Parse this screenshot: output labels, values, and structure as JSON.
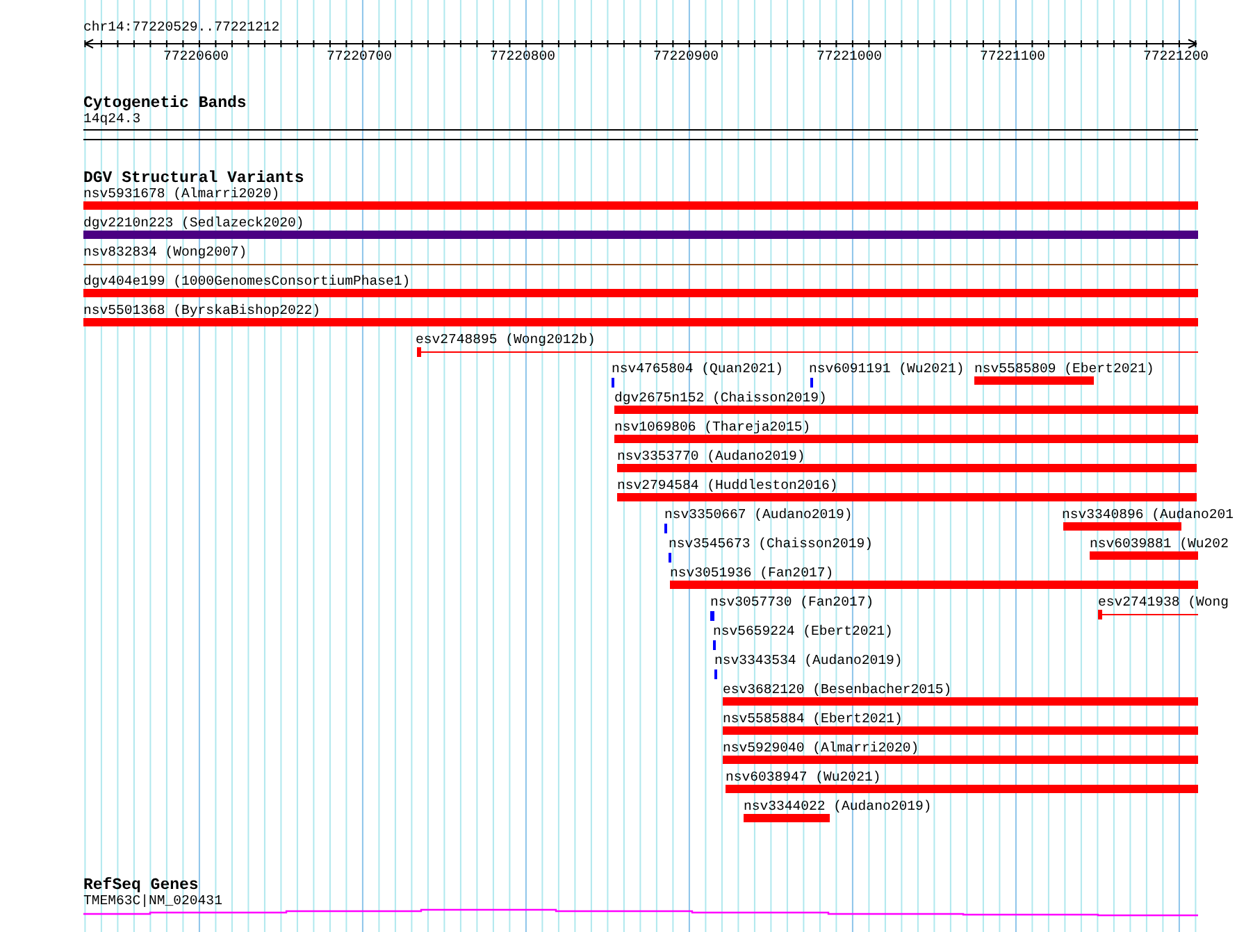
{
  "ruler": {
    "location": "chr14:77220529..77221212",
    "ticks": [
      "77220600",
      "77220700",
      "77220800",
      "77220900",
      "77221000",
      "77221100",
      "77221200"
    ]
  },
  "tracks": [
    {
      "kind": "bands",
      "title": "Cytogenetic Bands",
      "features": [
        {
          "label": "14q24.3"
        }
      ]
    },
    {
      "kind": "variants",
      "title": "DGV Structural Variants",
      "features": [
        {
          "label": "nsv5931678 (Almarri2020)",
          "kind": "bar",
          "color": "#ff0000"
        },
        {
          "label": "dgv2210n223 (Sedlazeck2020)",
          "kind": "bar",
          "color": "#4b0082"
        },
        {
          "label": "nsv832834 (Wong2007)",
          "kind": "line",
          "color": "#8b4513"
        },
        {
          "label": "dgv404e199 (1000GenomesConsortiumPhase1)",
          "kind": "bar",
          "color": "#ff0000"
        },
        {
          "label": "nsv5501368 (ByrskaBishop2022)",
          "kind": "bar",
          "color": "#ff0000"
        },
        {
          "label": "esv2748895 (Wong2012b)",
          "kind": "line",
          "color": "#ff0000"
        },
        {
          "label": "nsv4765804 (Quan2021)",
          "kind": "tick",
          "color": "#0000ff"
        },
        {
          "label": "nsv6091191 (Wu2021)",
          "kind": "tick",
          "color": "#0000ff"
        },
        {
          "label": "nsv5585809 (Ebert2021)",
          "kind": "bar",
          "color": "#ff0000"
        },
        {
          "label": "dgv2675n152 (Chaisson2019)",
          "kind": "bar",
          "color": "#ff0000"
        },
        {
          "label": "nsv1069806 (Thareja2015)",
          "kind": "bar",
          "color": "#ff0000"
        },
        {
          "label": "nsv3353770 (Audano2019)",
          "kind": "bar",
          "color": "#ff0000"
        },
        {
          "label": "nsv2794584 (Huddleston2016)",
          "kind": "bar",
          "color": "#ff0000"
        },
        {
          "label": "nsv3350667 (Audano2019)",
          "kind": "tick",
          "color": "#0000ff"
        },
        {
          "label": "nsv3340896 (Audano201",
          "kind": "bar",
          "color": "#ff0000"
        },
        {
          "label": "nsv3545673 (Chaisson2019)",
          "kind": "tick",
          "color": "#0000ff"
        },
        {
          "label": "nsv6039881 (Wu202",
          "kind": "bar",
          "color": "#ff0000"
        },
        {
          "label": "nsv3051936 (Fan2017)",
          "kind": "bar",
          "color": "#ff0000"
        },
        {
          "label": "nsv3057730 (Fan2017)",
          "kind": "tick",
          "color": "#0000ff"
        },
        {
          "label": "esv2741938 (Wong",
          "kind": "line",
          "color": "#ff0000"
        },
        {
          "label": "nsv5659224 (Ebert2021)",
          "kind": "tick",
          "color": "#0000ff"
        },
        {
          "label": "nsv3343534 (Audano2019)",
          "kind": "tick",
          "color": "#0000ff"
        },
        {
          "label": "esv3682120 (Besenbacher2015)",
          "kind": "bar",
          "color": "#ff0000"
        },
        {
          "label": "nsv5585884 (Ebert2021)",
          "kind": "bar",
          "color": "#ff0000"
        },
        {
          "label": "nsv5929040 (Almarri2020)",
          "kind": "bar",
          "color": "#ff0000"
        },
        {
          "label": "nsv6038947 (Wu2021)",
          "kind": "bar",
          "color": "#ff0000"
        },
        {
          "label": "nsv3344022 (Audano2019)",
          "kind": "bar",
          "color": "#ff0000"
        }
      ]
    },
    {
      "kind": "genes",
      "title": "RefSeq Genes",
      "features": [
        {
          "label": "TMEM63C|NM_020431",
          "color": "#ff00ff"
        }
      ]
    }
  ]
}
